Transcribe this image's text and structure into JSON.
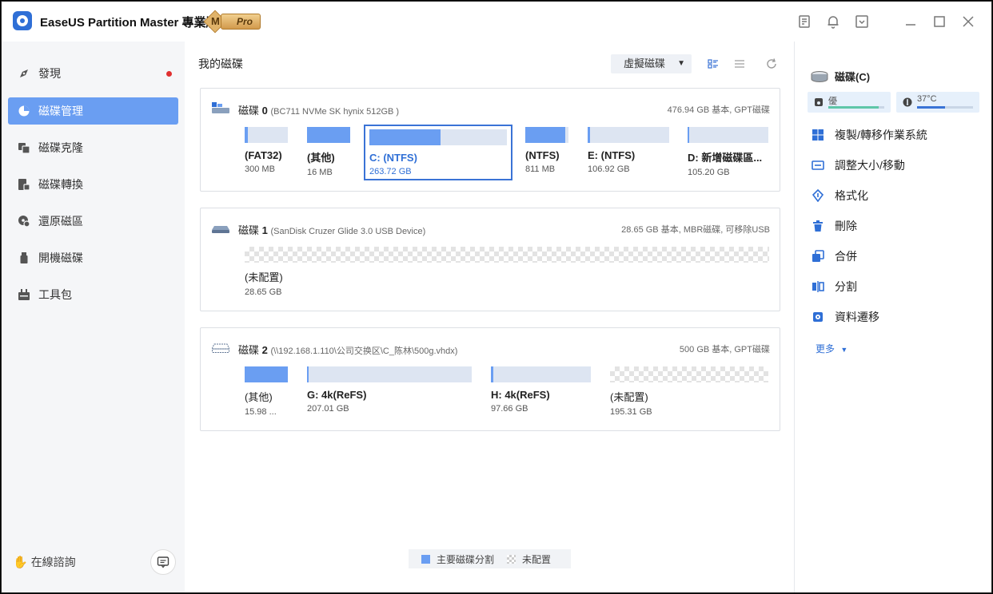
{
  "app": {
    "title": "EaseUS Partition Master 專業版",
    "badge_letter": "M",
    "badge_label": "Pro"
  },
  "sidebar": {
    "items": [
      {
        "label": "發現",
        "icon": "compass-icon"
      },
      {
        "label": "磁碟管理",
        "icon": "pie-chart-icon"
      },
      {
        "label": "磁碟克隆",
        "icon": "clone-icon"
      },
      {
        "label": "磁碟轉換",
        "icon": "convert-icon"
      },
      {
        "label": "還原磁區",
        "icon": "recover-icon"
      },
      {
        "label": "開機磁碟",
        "icon": "usb-icon"
      },
      {
        "label": "工具包",
        "icon": "toolbox-icon"
      }
    ],
    "consult_label": "在線諮詢"
  },
  "main": {
    "title": "我的磁碟",
    "virtual_disk_label": "虛擬磁碟",
    "disks": [
      {
        "name": "磁碟",
        "number": "0",
        "model": "(BC711 NVMe SK hynix 512GB )",
        "info": "476.94 GB 基本, GPT磁碟",
        "partitions": [
          {
            "label": "(FAT32)",
            "size": "300 MB",
            "used": 0.08
          },
          {
            "label": "(其他)",
            "size": "16 MB",
            "used": 1.0
          },
          {
            "label": "C: (NTFS)",
            "size": "263.72 GB",
            "used": 0.52,
            "selected": true
          },
          {
            "label": "(NTFS)",
            "size": "811 MB",
            "used": 0.92
          },
          {
            "label": "E: (NTFS)",
            "size": "106.92 GB",
            "used": 0.03
          },
          {
            "label": "D: 新增磁碟區...",
            "size": "105.20 GB",
            "used": 0.02
          }
        ]
      },
      {
        "name": "磁碟",
        "number": "1",
        "model": "(SanDisk Cruzer Glide 3.0 USB Device)",
        "info": "28.65 GB 基本, MBR磁碟, 可移除USB",
        "partitions": [
          {
            "label": "(未配置)",
            "size": "28.65 GB",
            "unallocated": true
          }
        ]
      },
      {
        "name": "磁碟",
        "number": "2",
        "model": "(\\\\192.168.1.110\\公司交换区\\C_陈林\\500g.vhdx)",
        "info": "500 GB 基本, GPT磁碟",
        "partitions": [
          {
            "label": "(其他)",
            "size": "15.98 ...",
            "used": 1.0
          },
          {
            "label": "G: 4k(ReFS)",
            "size": "207.01 GB",
            "used": 0.01
          },
          {
            "label": "H: 4k(ReFS)",
            "size": "97.66 GB",
            "used": 0.02
          },
          {
            "label": "(未配置)",
            "size": "195.31 GB",
            "unallocated": true
          }
        ]
      }
    ],
    "legend": {
      "primary_label": "主要磁碟分割",
      "unallocated_label": "未配置"
    }
  },
  "right_panel": {
    "disk_label": "磁碟(C)",
    "health_label": "優",
    "health_level": 0.9,
    "temp_label": "37°C",
    "temp_level": 0.5,
    "operations": [
      {
        "label": "複製/轉移作業系統",
        "icon": "windows-icon"
      },
      {
        "label": "調整大小/移動",
        "icon": "resize-icon"
      },
      {
        "label": "格式化",
        "icon": "format-icon"
      },
      {
        "label": "刪除",
        "icon": "trash-icon"
      },
      {
        "label": "合併",
        "icon": "merge-icon"
      },
      {
        "label": "分割",
        "icon": "split-icon"
      },
      {
        "label": "資料遷移",
        "icon": "migrate-icon"
      }
    ],
    "more_label": "更多"
  },
  "colors": {
    "accent": "#6a9ef2",
    "selected_border": "#3a73d6",
    "health_fill": "#5ec6a8",
    "temp_fill": "#3a73d6"
  }
}
